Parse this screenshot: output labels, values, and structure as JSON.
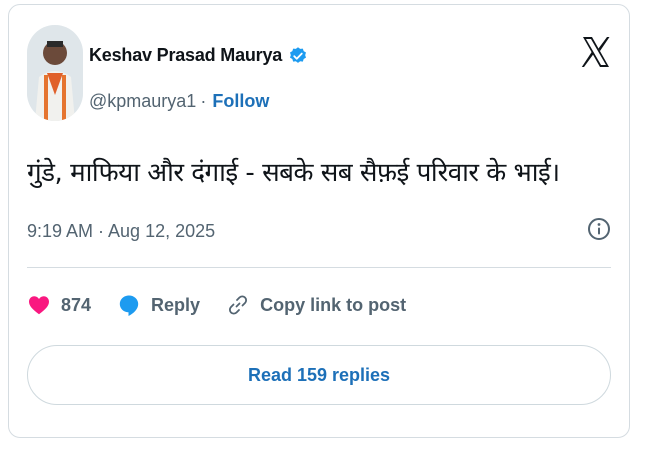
{
  "author": {
    "name": "Keshav Prasad Maurya",
    "handle": "@kpmaurya1",
    "separator": "·",
    "follow_label": "Follow"
  },
  "tweet": {
    "text": "गुंडे, माफिया और दंगाई - सबके सब सैफ़ई परिवार के भाई।",
    "timestamp": "9:19 AM · Aug 12, 2025"
  },
  "actions": {
    "like_count": "874",
    "reply_label": "Reply",
    "copy_label": "Copy link to post"
  },
  "read_replies_label": "Read 159 replies",
  "icons": {
    "logo": "x-logo-icon",
    "verified": "verified-badge-icon",
    "info": "info-icon",
    "like": "heart-icon",
    "reply": "reply-bubble-icon",
    "copy": "link-icon"
  },
  "colors": {
    "link_blue": "#1d70b8",
    "verified_blue": "#1d9bf0",
    "like_pink": "#f91880",
    "muted": "#536471"
  }
}
